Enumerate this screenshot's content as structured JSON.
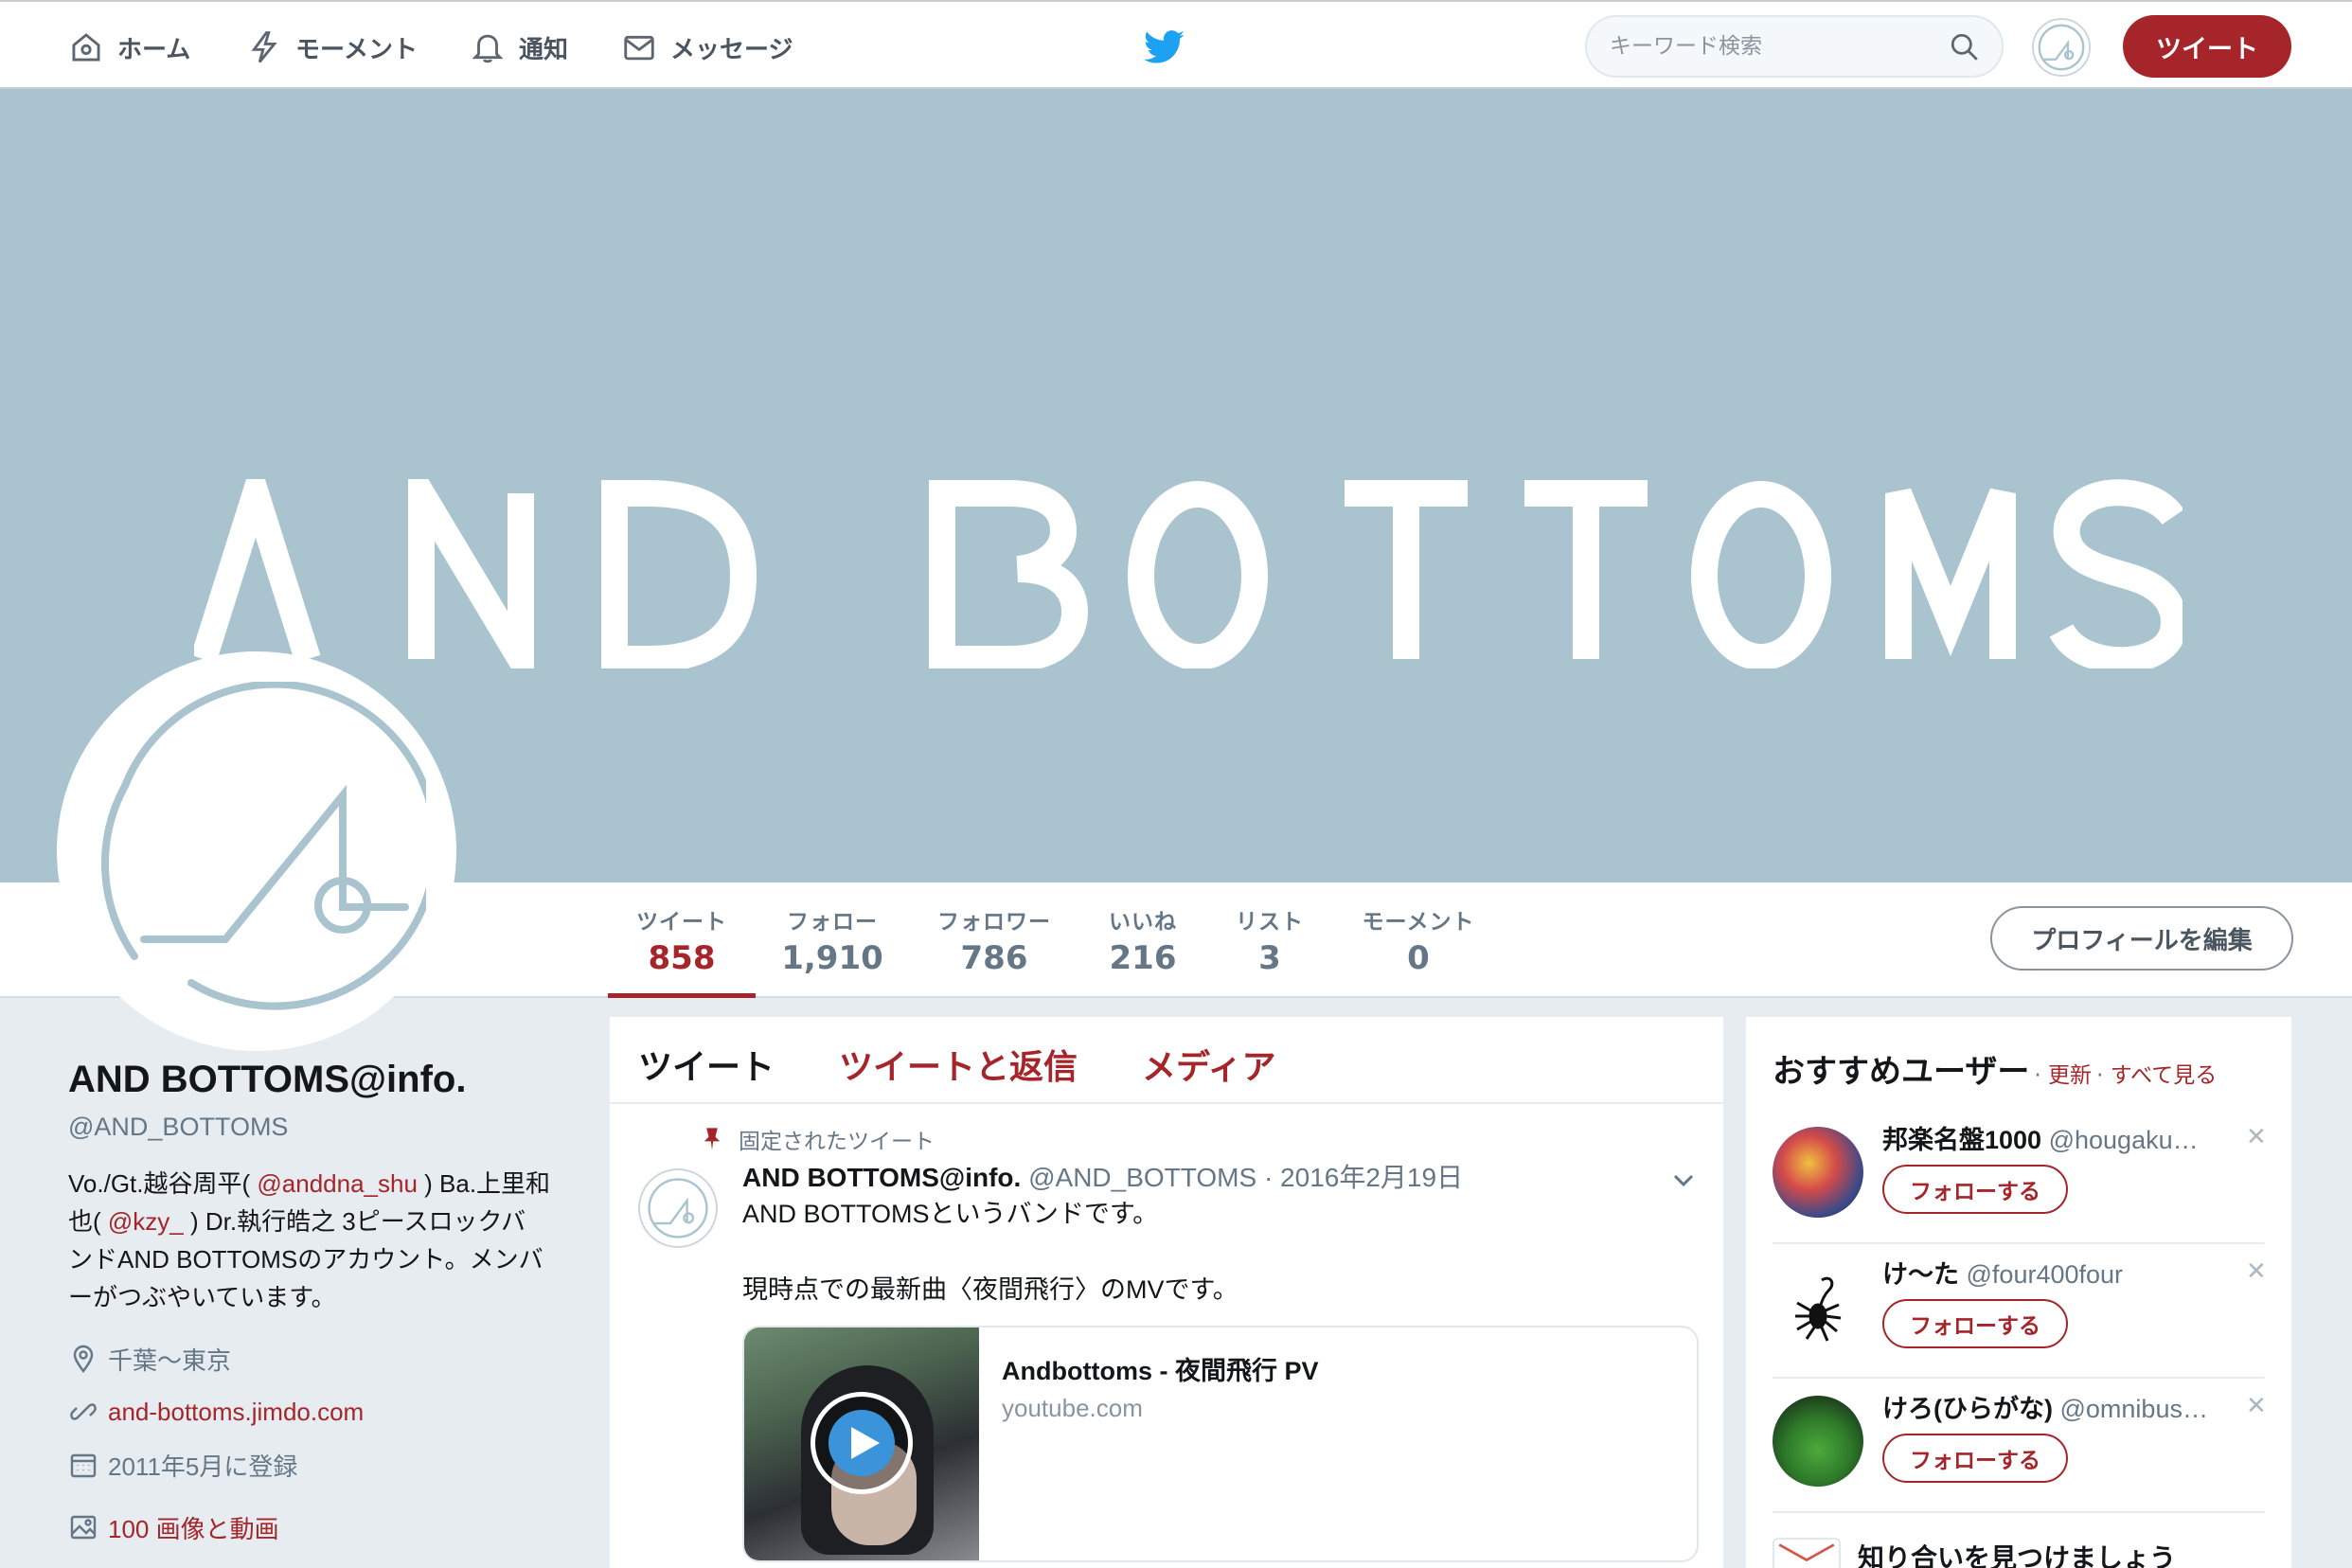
{
  "nav": {
    "home": "ホーム",
    "moments": "モーメント",
    "notifications": "通知",
    "messages": "メッセージ",
    "search_placeholder": "キーワード検索",
    "tweet_button": "ツイート"
  },
  "banner": {
    "text": "AND BOTTOMS"
  },
  "stats": [
    {
      "label": "ツイート",
      "value": "858"
    },
    {
      "label": "フォロー",
      "value": "1,910"
    },
    {
      "label": "フォロワー",
      "value": "786"
    },
    {
      "label": "いいね",
      "value": "216"
    },
    {
      "label": "リスト",
      "value": "3"
    },
    {
      "label": "モーメント",
      "value": "0"
    }
  ],
  "edit_profile": "プロフィールを編集",
  "profile": {
    "name": "AND BOTTOMS@info.",
    "handle": "@AND_BOTTOMS",
    "bio_1": "Vo./Gt.越谷周平( ",
    "bio_link1": "@anddna_shu",
    "bio_2": " ) Ba.上里和也( ",
    "bio_link2": "@kzy_",
    "bio_3": " ) Dr.執行皓之 3ピースロックバンドAND BOTTOMSのアカウント。メンバーがつぶやいています。",
    "location": "千葉〜東京",
    "website": "and-bottoms.jimdo.com",
    "joined": "2011年5月に登録",
    "media": "100 画像と動画"
  },
  "timeline": {
    "tabs": [
      "ツイート",
      "ツイートと返信",
      "メディア"
    ],
    "pinned_label": "固定されたツイート",
    "tweet": {
      "name": "AND BOTTOMS@info.",
      "handle": "@AND_BOTTOMS",
      "date": "· 2016年2月19日",
      "line1": "AND BOTTOMSというバンドです。",
      "line2": "現時点での最新曲〈夜間飛行〉のMVです。",
      "card_title": "Andbottoms - 夜間飛行 PV",
      "card_url": "youtube.com"
    }
  },
  "who_to_follow": {
    "title": "おすすめユーザー",
    "refresh": "更新",
    "view_all": "すべて見る",
    "sep": " · ",
    "follow_label": "フォローする",
    "users": [
      {
        "name": "邦楽名盤1000",
        "handle": "@hougaku…"
      },
      {
        "name": "け〜た",
        "handle": "@four400four"
      },
      {
        "name": "けろ(ひらがな)",
        "handle": "@omnibus…"
      }
    ],
    "find_friends": "知り合いを見つけましょう"
  },
  "colors": {
    "accent": "#a5252a",
    "banner": "#a9c4cf"
  }
}
